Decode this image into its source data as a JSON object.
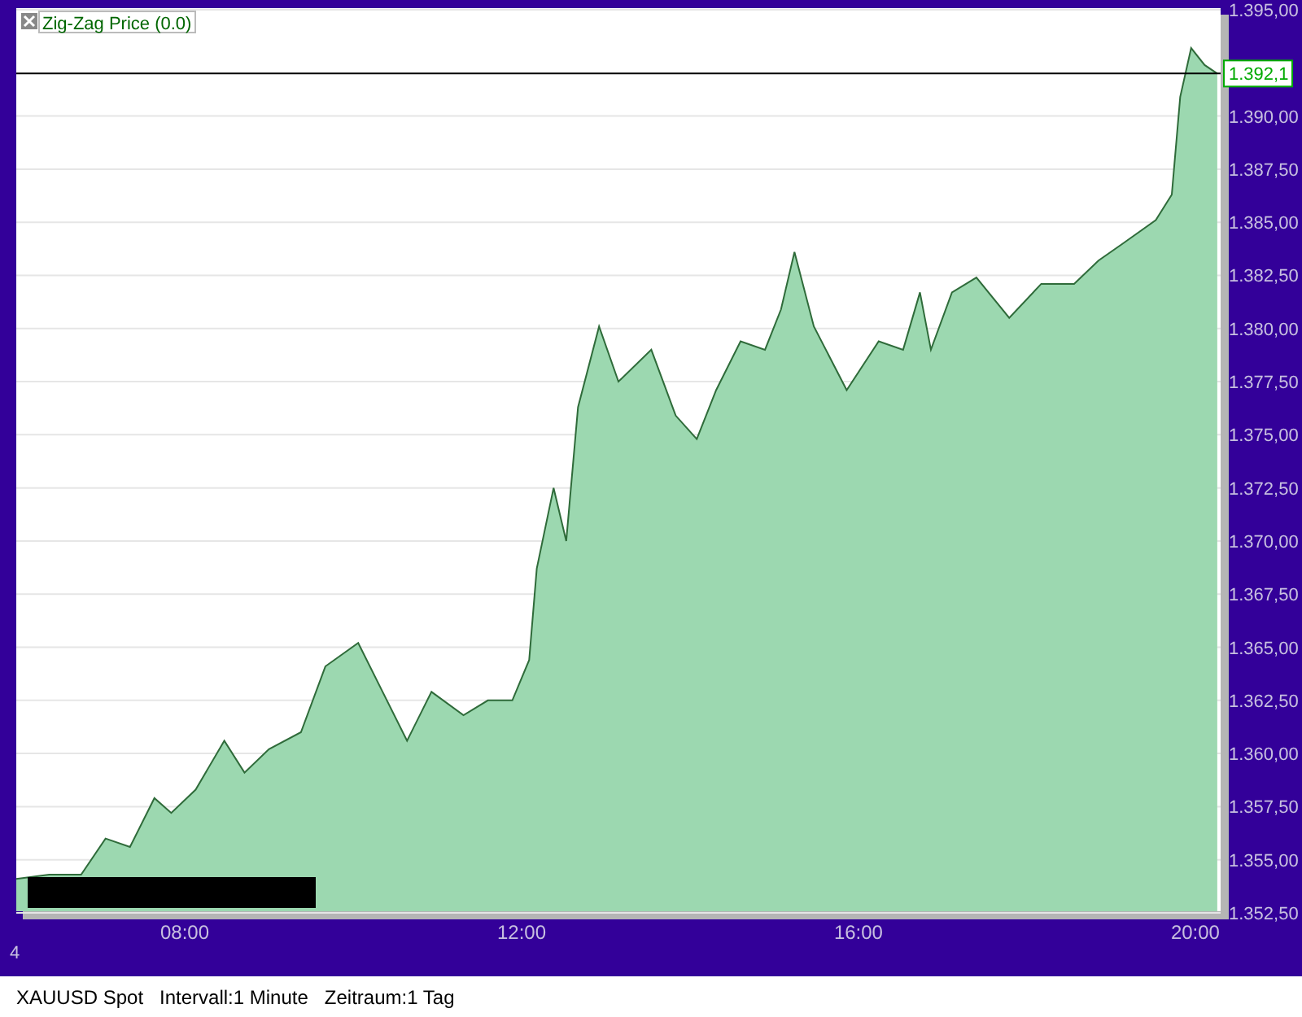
{
  "chart": {
    "chart_data": {
      "type": "area",
      "xlim": [
        6,
        20.3
      ],
      "ylim": [
        1352.5,
        1395
      ],
      "xticks": [
        {
          "value": 8,
          "label": "08:00"
        },
        {
          "value": 12,
          "label": "12:00"
        },
        {
          "value": 16,
          "label": "16:00"
        },
        {
          "value": 20,
          "label": "20:00"
        }
      ],
      "yticks": [
        {
          "value": 1352.5,
          "label": "1.352,50"
        },
        {
          "value": 1355,
          "label": "1.355,00"
        },
        {
          "value": 1357.5,
          "label": "1.357,50"
        },
        {
          "value": 1360,
          "label": "1.360,00"
        },
        {
          "value": 1362.5,
          "label": "1.362,50"
        },
        {
          "value": 1365,
          "label": "1.365,00"
        },
        {
          "value": 1367.5,
          "label": "1.367,50"
        },
        {
          "value": 1370,
          "label": "1.370,00"
        },
        {
          "value": 1372.5,
          "label": "1.372,50"
        },
        {
          "value": 1375,
          "label": "1.375,00"
        },
        {
          "value": 1377.5,
          "label": "1.377,50"
        },
        {
          "value": 1380,
          "label": "1.380,00"
        },
        {
          "value": 1382.5,
          "label": "1.382,50"
        },
        {
          "value": 1385,
          "label": "1.385,00"
        },
        {
          "value": 1387.5,
          "label": "1.387,50"
        },
        {
          "value": 1390,
          "label": "1.390,00"
        },
        {
          "value": 1395,
          "label": "1.395,00"
        }
      ],
      "x": [
        6.0,
        6.39,
        6.77,
        7.06,
        7.35,
        7.64,
        7.84,
        8.13,
        8.47,
        8.71,
        9.0,
        9.38,
        9.67,
        10.06,
        10.35,
        10.64,
        10.93,
        11.31,
        11.6,
        11.89,
        12.09,
        12.18,
        12.38,
        12.53,
        12.67,
        12.92,
        13.15,
        13.54,
        13.83,
        14.08,
        14.31,
        14.6,
        14.89,
        15.08,
        15.24,
        15.47,
        15.86,
        16.24,
        16.53,
        16.73,
        16.86,
        17.11,
        17.4,
        17.79,
        18.17,
        18.56,
        18.85,
        19.14,
        19.53,
        19.72,
        19.82,
        19.95,
        20.11,
        20.26
      ],
      "series": [
        {
          "name": "Zig-Zag Price (0.0)",
          "color": "#9cd8b0",
          "values": [
            1354.1,
            1354.3,
            1354.3,
            1356.0,
            1355.6,
            1357.9,
            1357.2,
            1358.3,
            1360.6,
            1359.1,
            1360.2,
            1361.0,
            1364.1,
            1365.2,
            1362.9,
            1360.6,
            1362.9,
            1361.8,
            1362.5,
            1362.5,
            1364.4,
            1368.7,
            1372.5,
            1370.0,
            1376.3,
            1380.1,
            1377.5,
            1379.0,
            1375.9,
            1374.8,
            1377.1,
            1379.4,
            1379.0,
            1380.9,
            1383.6,
            1380.1,
            1377.1,
            1379.4,
            1379.0,
            1381.7,
            1379.0,
            1381.7,
            1382.4,
            1380.5,
            1382.1,
            1382.1,
            1383.2,
            1384.0,
            1385.1,
            1386.3,
            1390.9,
            1393.2,
            1392.4,
            1392.0
          ]
        }
      ],
      "grid": true
    },
    "last_price_label": "1.392,1",
    "corner_label": "4"
  },
  "status_bar": {
    "items": [
      "XAUUSD Spot",
      "Intervall:1 Minute",
      "Zeitraum:1 Tag"
    ]
  }
}
